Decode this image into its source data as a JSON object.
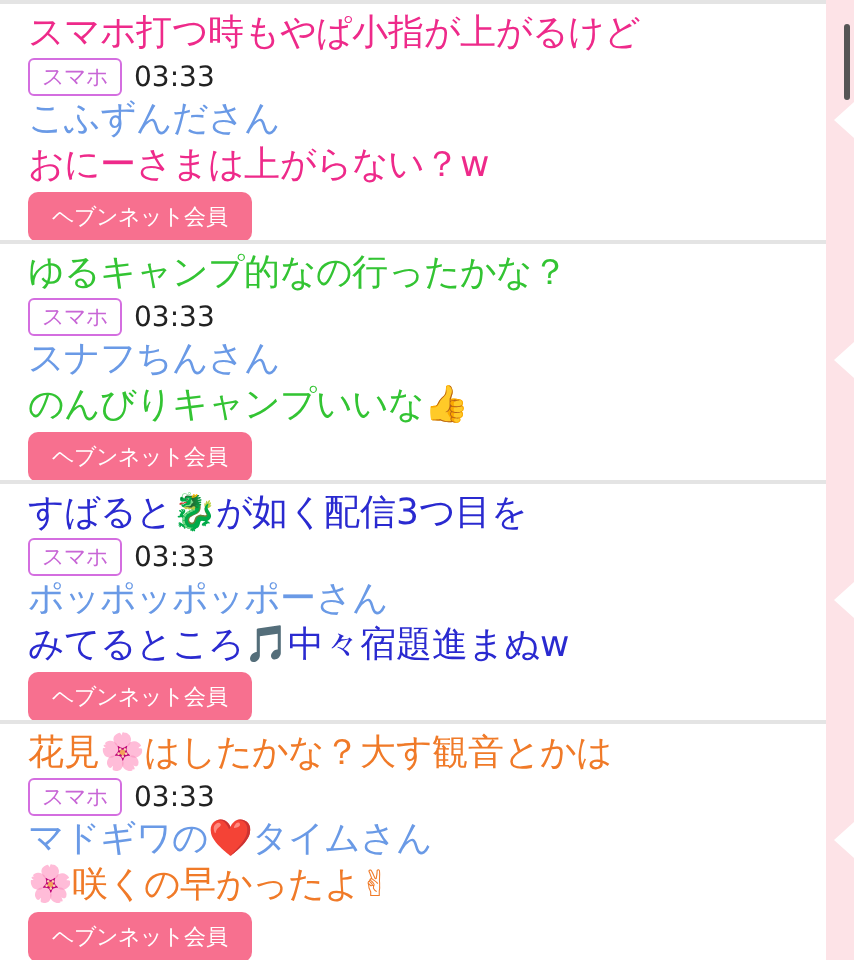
{
  "comments": [
    {
      "caption": [
        "スマホ打つ時もやぱ小指が上がるけど",
        "おにーさまは上がらない？w"
      ],
      "color": "#ee2a8a",
      "tag": "スマホ",
      "time": "03:33",
      "name": "こふずんださん",
      "badge": "ヘブンネット会員"
    },
    {
      "caption": [
        "ゆるキャンプ的なの行ったかな？",
        "のんびりキャンプいいな👍"
      ],
      "color": "#33c433",
      "tag": "スマホ",
      "time": "03:33",
      "name": "スナフちんさん",
      "badge": "ヘブンネット会員"
    },
    {
      "caption": [
        "すばると🐉が如く配信3つ目を",
        "みてるところ🎵中々宿題進まぬw"
      ],
      "color": "#2a2ad0",
      "tag": "スマホ",
      "time": "03:33",
      "name": "ポッポッポッポーさん",
      "badge": "ヘブンネット会員"
    },
    {
      "caption": [
        "花見🌸はしたかな？大す観音とかは",
        "🌸咲くの早かったよ✌"
      ],
      "color": "#f07a28",
      "tag": "スマホ",
      "time": "03:33",
      "name": "マドギワの❤️タイムさん",
      "badge": "ヘブンネット会員"
    }
  ]
}
